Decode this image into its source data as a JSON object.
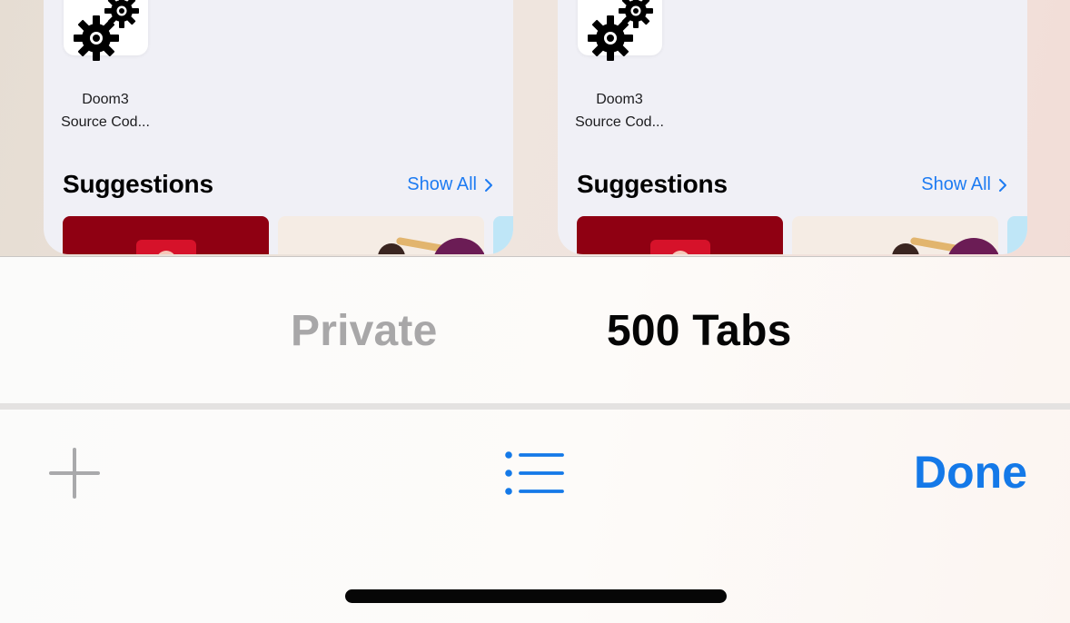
{
  "tab_cards": [
    {
      "favorite": {
        "icon": "gears-icon",
        "title_line1": "Doom3",
        "title_line2": "Source Cod..."
      },
      "suggestions": {
        "heading": "Suggestions",
        "show_all": "Show All"
      }
    },
    {
      "favorite": {
        "icon": "gears-icon",
        "title_line1": "Doom3",
        "title_line2": "Source Cod..."
      },
      "suggestions": {
        "heading": "Suggestions",
        "show_all": "Show All"
      }
    }
  ],
  "tab_group_switcher": {
    "private_label": "Private",
    "tabs_label": "500 Tabs",
    "selected": "500 Tabs"
  },
  "toolbar": {
    "new_tab_icon": "plus-icon",
    "tab_groups_icon": "list-icon",
    "done_label": "Done"
  },
  "colors": {
    "accent": "#1479e8",
    "inactive_text": "#a8a7a8",
    "card_background": "#f0f0f6"
  }
}
